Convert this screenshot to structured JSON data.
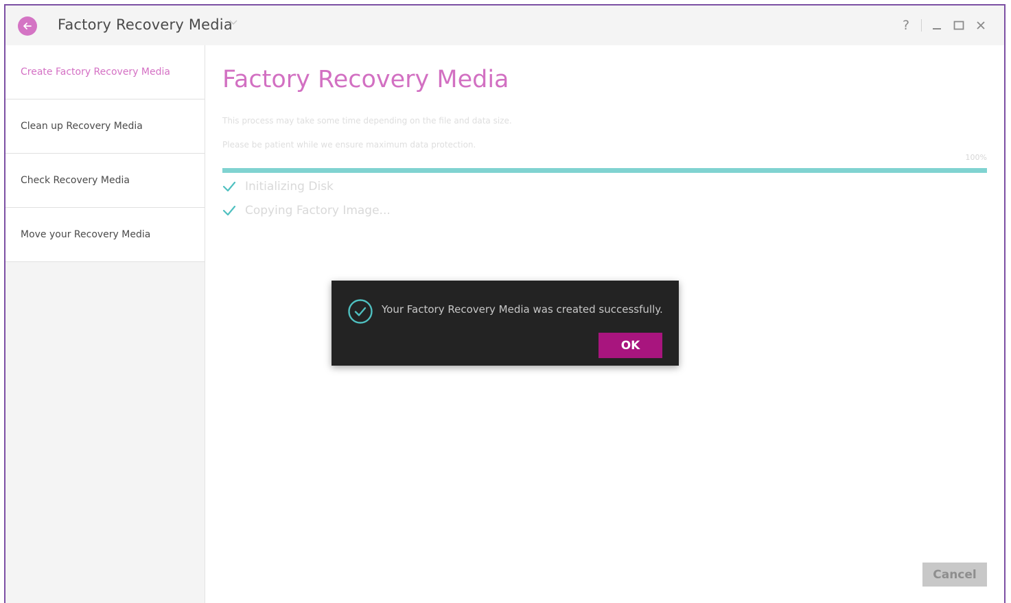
{
  "app": {
    "title": "Factory Recovery Media"
  },
  "window_controls": {
    "help": "?",
    "minimize": "_",
    "maximize": "□",
    "close": "✕"
  },
  "sidebar": {
    "items": [
      {
        "label": "Create Factory Recovery Media",
        "active": true
      },
      {
        "label": "Clean up Recovery Media",
        "active": false
      },
      {
        "label": "Check Recovery Media",
        "active": false
      },
      {
        "label": "Move your Recovery Media",
        "active": false
      }
    ]
  },
  "main": {
    "title": "Factory Recovery Media",
    "info_line_1": "This process may take some time depending on the file and data size.",
    "info_line_2": "Please be patient while we ensure maximum data protection.",
    "progress_label": "100%",
    "progress_value": 1.0,
    "steps": [
      {
        "label": "Initializing Disk",
        "done": true
      },
      {
        "label": "Copying Factory Image...",
        "done": true
      }
    ],
    "cancel_label": "Cancel"
  },
  "dialog": {
    "message": "Your Factory Recovery Media was created successfully.",
    "ok_label": "OK"
  },
  "colors": {
    "accent": "#d270c2",
    "window_border": "#7b4ea3",
    "progress": "#80d3d1",
    "ok_button": "#a8157e",
    "check_icon": "#4fc0c0"
  }
}
